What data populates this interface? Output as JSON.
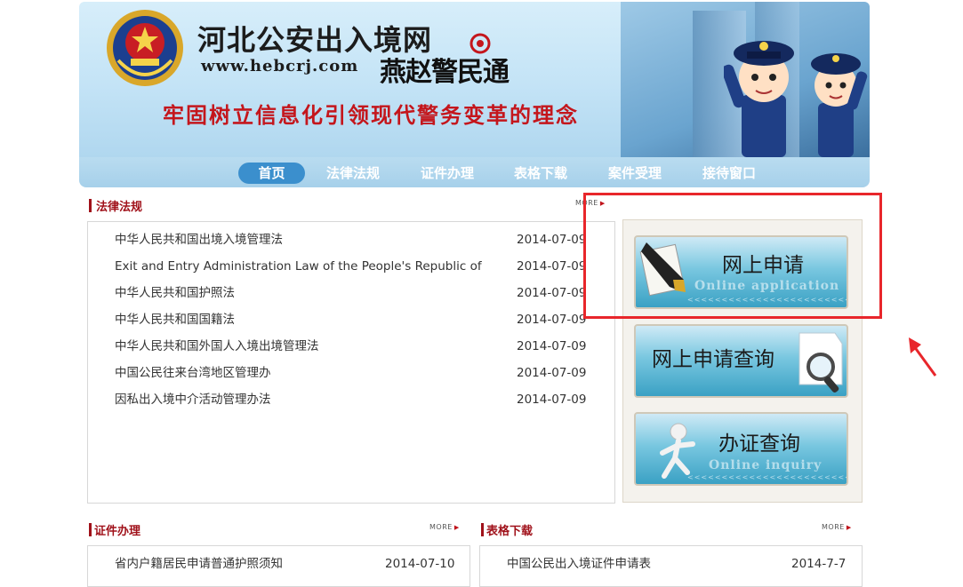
{
  "header": {
    "site_title": "河北公安出入境网",
    "site_url": "www.hebcrj.com",
    "brand": "燕赵警民通",
    "slogan": "牢固树立信息化引领现代警务变革的理念"
  },
  "nav": {
    "items": [
      {
        "label": "首页",
        "active": true
      },
      {
        "label": "法律法规"
      },
      {
        "label": "证件办理"
      },
      {
        "label": "表格下载"
      },
      {
        "label": "案件受理"
      },
      {
        "label": "接待窗口"
      }
    ]
  },
  "laws": {
    "title": "法律法规",
    "more": "MORE",
    "items": [
      {
        "title": "中华人民共和国出境入境管理法",
        "date": "2014-07-09"
      },
      {
        "title": "Exit and Entry Administration Law of the People's Republic of",
        "date": "2014-07-09"
      },
      {
        "title": "中华人民共和国护照法",
        "date": "2014-07-09"
      },
      {
        "title": "中华人民共和国国籍法",
        "date": "2014-07-09"
      },
      {
        "title": "中华人民共和国外国人入境出境管理法",
        "date": "2014-07-09"
      },
      {
        "title": "中国公民往来台湾地区管理办",
        "date": "2014-07-09"
      },
      {
        "title": "因私出入境中介活动管理办法",
        "date": "2014-07-09"
      }
    ]
  },
  "services": {
    "buttons": [
      {
        "label": "网上申请",
        "en": "Online application",
        "icon": "fountain-pen-icon"
      },
      {
        "label": "网上申请查询",
        "en": "",
        "icon": "magnifier-document-icon"
      },
      {
        "label": "办证查询",
        "en": "Online inquiry",
        "icon": "runner-figure-icon"
      }
    ]
  },
  "certs": {
    "title": "证件办理",
    "more": "MORE",
    "items": [
      {
        "title": "省内户籍居民申请普通护照须知",
        "date": "2014-07-10"
      }
    ]
  },
  "forms": {
    "title": "表格下载",
    "more": "MORE",
    "items": [
      {
        "title": "中国公民出入境证件申请表",
        "date": "2014-7-7"
      }
    ]
  },
  "colors": {
    "accent_red": "#a0111a",
    "nav_bg": "#a6d0ea",
    "nav_active": "#3b8fcd",
    "highlight": "#e8262b"
  }
}
